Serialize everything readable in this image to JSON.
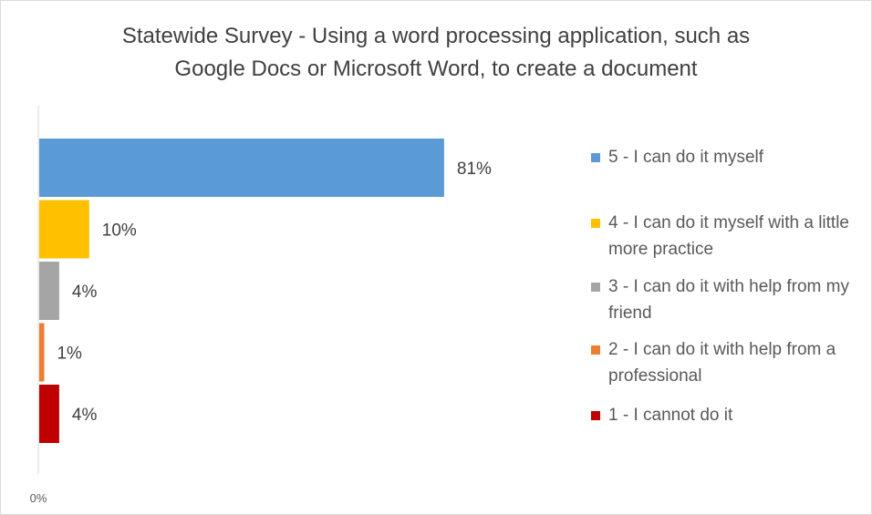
{
  "chart_data": {
    "type": "bar",
    "orientation": "horizontal",
    "title_lines": [
      "Statewide Survey - Using a word processing application, such as",
      "Google Docs or Microsoft Word, to create a document"
    ],
    "categories": [
      "5 - I can do it myself",
      "4 - I can do it myself with a little more practice",
      "3 - I can do it with help from my friend",
      "2 - I can do it with help from a professional",
      "1 - I cannot do it"
    ],
    "values": [
      81,
      10,
      4,
      1,
      4
    ],
    "data_labels": [
      "81%",
      "10%",
      "4%",
      "1%",
      "4%"
    ],
    "colors": [
      "#5B9BD5",
      "#FFC000",
      "#A5A5A5",
      "#ED7D31",
      "#C00000"
    ],
    "x_tick_labels": [
      "0%"
    ],
    "xlim": [
      0,
      100
    ],
    "legend_position": "right",
    "grid": false
  }
}
